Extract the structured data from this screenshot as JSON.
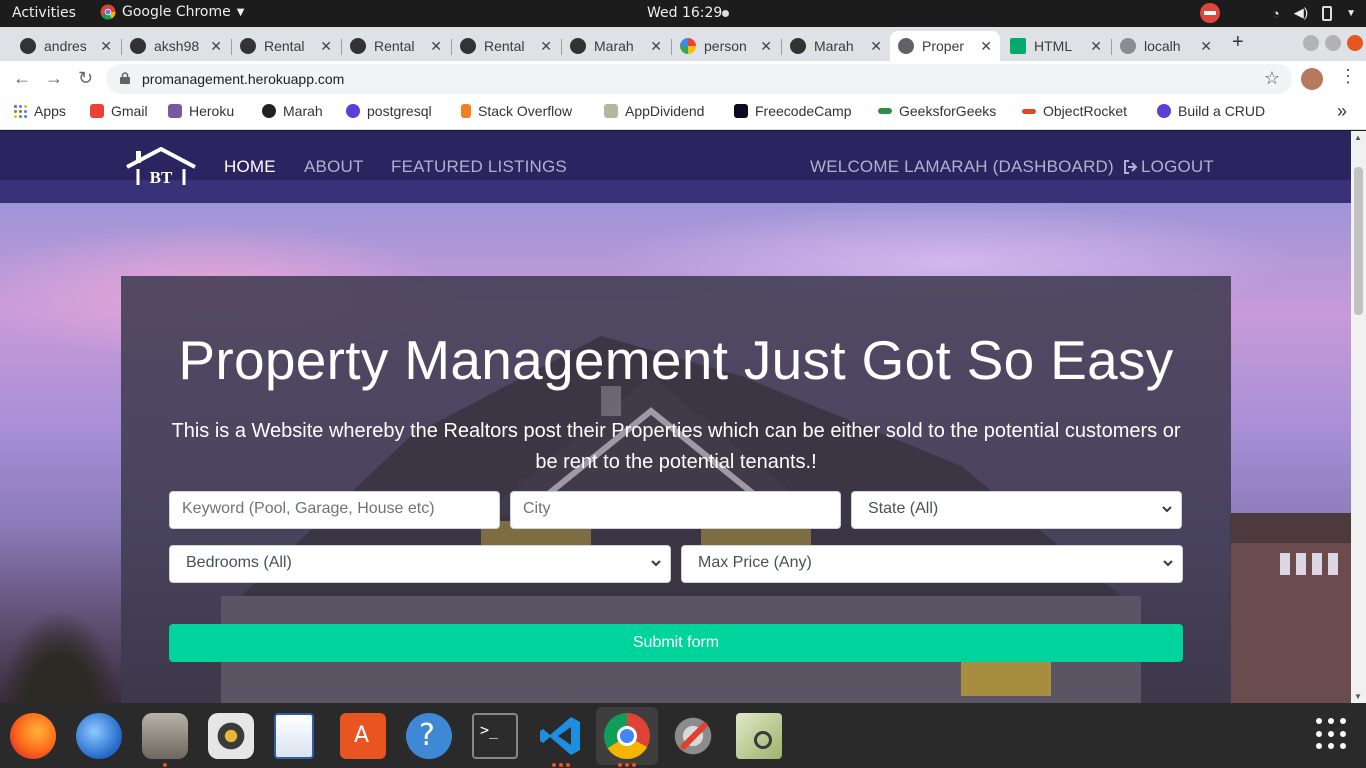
{
  "system": {
    "activities": "Activities",
    "app_name": "Google Chrome",
    "clock": "Wed 16:29"
  },
  "browser": {
    "tabs": [
      {
        "label": "andres",
        "icon": "github-icon"
      },
      {
        "label": "aksh98",
        "icon": "github-icon"
      },
      {
        "label": "Rental",
        "icon": "github-icon"
      },
      {
        "label": "Rental",
        "icon": "github-icon"
      },
      {
        "label": "Rental",
        "icon": "github-icon"
      },
      {
        "label": "Marah",
        "icon": "github-icon"
      },
      {
        "label": "person",
        "icon": "google-icon"
      },
      {
        "label": "Marah",
        "icon": "github-icon"
      },
      {
        "label": "Proper",
        "icon": "globe-icon",
        "active": true
      },
      {
        "label": "HTML",
        "icon": "w3-icon"
      },
      {
        "label": "localh",
        "icon": "globe-icon"
      }
    ],
    "url": "promanagement.herokuapp.com",
    "bookmarks": [
      "Apps",
      "Gmail",
      "Heroku",
      "Marah",
      "postgresql",
      "Stack Overflow",
      "AppDividend",
      "FreecodeCamp",
      "GeeksforGeeks",
      "ObjectRocket",
      "Build a CRUD"
    ],
    "overflow": "»"
  },
  "site": {
    "nav": {
      "home": "HOME",
      "about": "ABOUT",
      "featured": "FEATURED LISTINGS",
      "welcome": "WELCOME LAMARAH (DASHBOARD)",
      "logout": "LOGOUT"
    },
    "logo_text": "BT",
    "hero": {
      "title": "Property Management Just Got So Easy",
      "lead": "This is a Website whereby the Realtors post their Properties which can be either sold to the potential customers or be rent to the potential tenants.!"
    },
    "search": {
      "keyword_placeholder": "Keyword (Pool, Garage, House etc)",
      "city_placeholder": "City",
      "state": "State (All)",
      "bedrooms": "Bedrooms (All)",
      "max_price": "Max Price (Any)",
      "submit": "Submit form"
    },
    "colors": {
      "navbar": "#2c2460",
      "submit": "#00d49d"
    }
  }
}
